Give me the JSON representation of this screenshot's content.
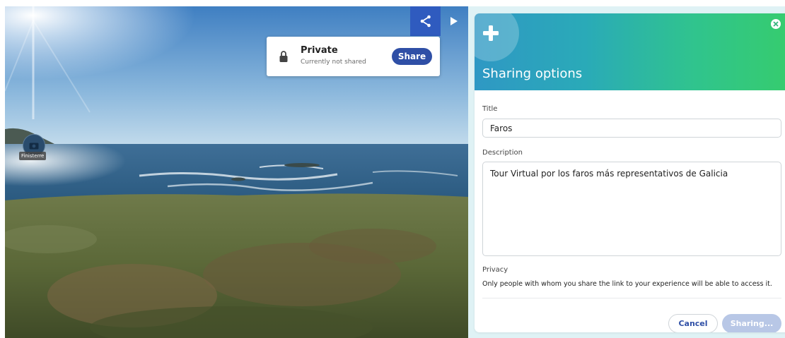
{
  "viewer": {
    "hotspot": {
      "label": "Finisterre",
      "icon": "photo-icon"
    },
    "share_icon": "share-icon",
    "play_icon": "play-icon",
    "privacy_popup": {
      "icon": "lock-icon",
      "title": "Private",
      "subtitle": "Currently not shared",
      "share_label": "Share"
    }
  },
  "panel": {
    "title": "Sharing options",
    "header_icon": "plus-icon",
    "close_icon": "close-icon",
    "title_label": "Title",
    "title_value": "Faros",
    "description_label": "Description",
    "description_value": "Tour Virtual por los faros más representativos de Galicia",
    "privacy_label": "Privacy",
    "privacy_text": "Only people with whom you share the link to your experience will be able to access it.",
    "cancel_label": "Cancel",
    "sharing_label": "Sharing..."
  },
  "colors": {
    "accent": "#2f4fa6",
    "share_tile": "#2f5bbf",
    "header_gradient_start": "#2f98c4",
    "header_gradient_end": "#36cc6e",
    "disabled_button": "#b8c7e6"
  }
}
